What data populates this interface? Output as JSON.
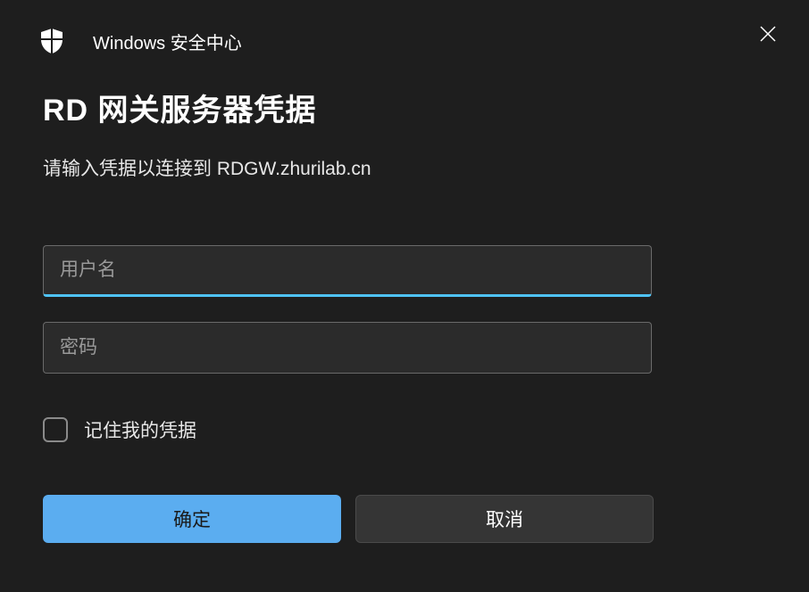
{
  "header": {
    "title": "Windows 安全中心"
  },
  "dialog": {
    "title": "RD 网关服务器凭据",
    "subtitle": "请输入凭据以连接到 RDGW.zhurilab.cn"
  },
  "inputs": {
    "username_placeholder": "用户名",
    "username_value": "",
    "password_placeholder": "密码",
    "password_value": ""
  },
  "checkbox": {
    "label": "记住我的凭据",
    "checked": false
  },
  "buttons": {
    "ok_label": "确定",
    "cancel_label": "取消"
  }
}
